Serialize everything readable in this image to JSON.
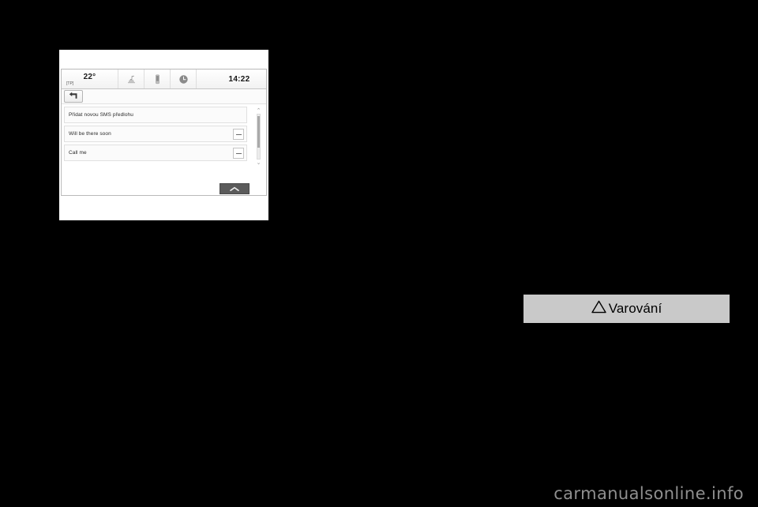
{
  "page": {
    "background_color": "#000000",
    "watermark": "carmanualsonline.info"
  },
  "infotainment": {
    "status_bar": {
      "temperature": "22°",
      "traffic_program": "[TP]",
      "clock": "14:22",
      "icons": [
        {
          "name": "media-audio-icon",
          "glyph": "media"
        },
        {
          "name": "phone-device-icon",
          "glyph": "phone"
        },
        {
          "name": "clock-info-icon",
          "glyph": "clock"
        }
      ]
    },
    "toolbar": {
      "back_button": {
        "name": "back-icon",
        "label": ""
      }
    },
    "list": {
      "items": [
        {
          "label": "Přidat novou SMS předlohu",
          "has_delete": false
        },
        {
          "label": "Will be there soon",
          "has_delete": true
        },
        {
          "label": "Call me",
          "has_delete": true
        }
      ],
      "scrollbar": {
        "up_arrow": "⌃",
        "down_arrow": "⌄"
      },
      "collapse_button": {
        "name": "chevron-up-icon"
      }
    }
  },
  "warning": {
    "icon": "warning-triangle-icon",
    "label": "Varování"
  }
}
